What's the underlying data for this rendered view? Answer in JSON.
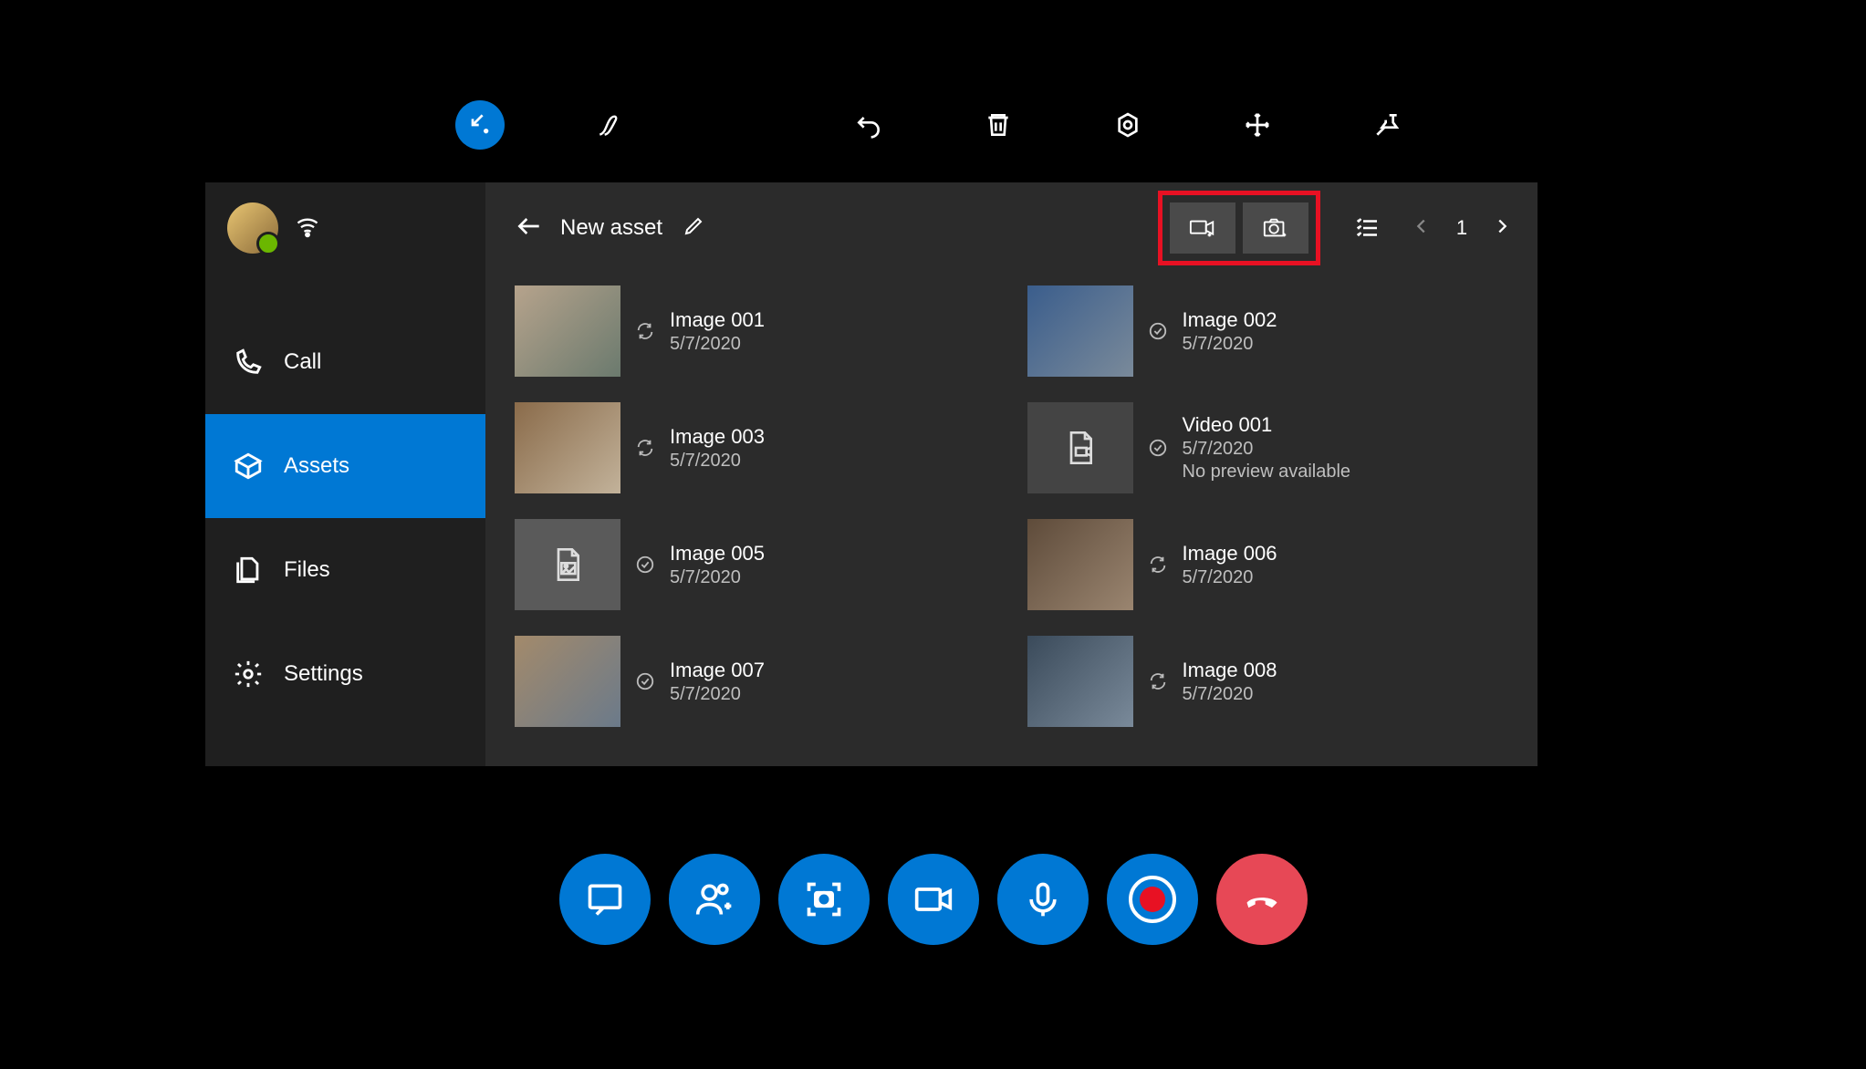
{
  "top_toolbar": {
    "items": [
      {
        "name": "arrow-collapse-icon",
        "active": true
      },
      {
        "name": "ink-pen-icon"
      },
      {
        "name": "stop-record-icon"
      },
      {
        "name": "undo-icon"
      },
      {
        "name": "delete-icon"
      },
      {
        "name": "shape-icon"
      },
      {
        "name": "arrows-move-icon"
      },
      {
        "name": "pin-icon"
      }
    ]
  },
  "sidebar": {
    "wifi_icon": "wifi-icon",
    "items": [
      {
        "label": "Call",
        "icon": "phone-icon",
        "active": false
      },
      {
        "label": "Assets",
        "icon": "package-icon",
        "active": true
      },
      {
        "label": "Files",
        "icon": "files-icon",
        "active": false
      },
      {
        "label": "Settings",
        "icon": "gear-icon",
        "active": false
      }
    ]
  },
  "header": {
    "title": "New asset",
    "back_icon": "back-arrow-icon",
    "edit_icon": "pencil-icon",
    "video_capture_icon": "video-add-icon",
    "photo_capture_icon": "camera-add-icon",
    "list_icon": "checklist-icon",
    "prev_icon": "chevron-left-icon",
    "page": "1",
    "next_icon": "chevron-right-icon"
  },
  "assets": [
    {
      "name": "Image 001",
      "date": "5/7/2020",
      "status": "sync",
      "thumb": "img-a"
    },
    {
      "name": "Image 002",
      "date": "5/7/2020",
      "status": "done",
      "thumb": "img-b"
    },
    {
      "name": "Image 003",
      "date": "5/7/2020",
      "status": "sync",
      "thumb": "img-c"
    },
    {
      "name": "Video 001",
      "date": "5/7/2020",
      "status": "done",
      "thumb": "placeholder",
      "sub": "No preview available",
      "filetype": "video"
    },
    {
      "name": "Image 005",
      "date": "5/7/2020",
      "status": "done",
      "thumb": "placeholder-img",
      "filetype": "image"
    },
    {
      "name": "Image 006",
      "date": "5/7/2020",
      "status": "sync",
      "thumb": "img-d"
    },
    {
      "name": "Image 007",
      "date": "5/7/2020",
      "status": "done",
      "thumb": "img-e"
    },
    {
      "name": "Image 008",
      "date": "5/7/2020",
      "status": "sync",
      "thumb": "img-f"
    }
  ],
  "call_bar": {
    "items": [
      {
        "name": "chat-icon"
      },
      {
        "name": "add-people-icon"
      },
      {
        "name": "screenshot-icon"
      },
      {
        "name": "video-icon"
      },
      {
        "name": "mic-icon"
      },
      {
        "name": "record-icon"
      },
      {
        "name": "hangup-icon",
        "red": true
      }
    ]
  }
}
